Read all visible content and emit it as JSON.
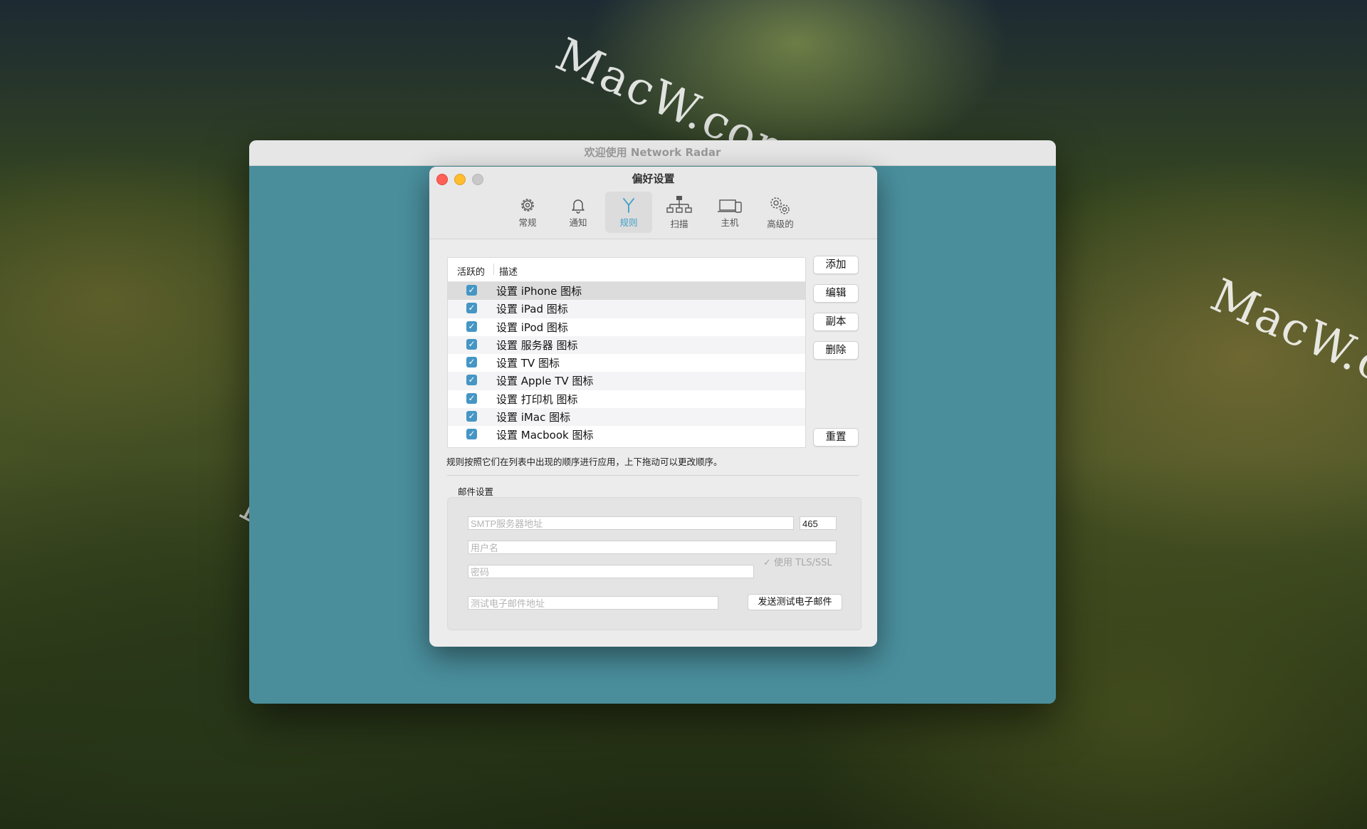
{
  "app_window": {
    "title": "欢迎使用 Network Radar"
  },
  "watermark": "MacW.com",
  "prefs": {
    "title": "偏好设置",
    "tabs": [
      {
        "label": "常规",
        "icon": "gear-icon"
      },
      {
        "label": "通知",
        "icon": "bell-icon"
      },
      {
        "label": "规则",
        "icon": "rules-icon",
        "active": true
      },
      {
        "label": "扫描",
        "icon": "network-tree-icon"
      },
      {
        "label": "主机",
        "icon": "devices-icon"
      },
      {
        "label": "高级的",
        "icon": "gears-icon"
      }
    ],
    "rules": {
      "columns": {
        "active": "活跃的",
        "description": "描述"
      },
      "rows": [
        {
          "checked": true,
          "text": "设置 iPhone 图标"
        },
        {
          "checked": true,
          "text": "设置 iPad 图标"
        },
        {
          "checked": true,
          "text": "设置 iPod 图标"
        },
        {
          "checked": true,
          "text": "设置 服务器 图标"
        },
        {
          "checked": true,
          "text": "设置 TV 图标"
        },
        {
          "checked": true,
          "text": "设置 Apple TV 图标"
        },
        {
          "checked": true,
          "text": "设置 打印机 图标"
        },
        {
          "checked": true,
          "text": "设置 iMac 图标"
        },
        {
          "checked": true,
          "text": "设置 Macbook 图标"
        }
      ],
      "buttons": {
        "add": "添加",
        "edit": "编辑",
        "duplicate": "副本",
        "delete": "删除",
        "reset": "重置"
      },
      "hint": "规则按照它们在列表中出现的顺序进行应用，上下拖动可以更改顺序。"
    },
    "mail": {
      "label": "邮件设置",
      "smtp_placeholder": "SMTP服务器地址",
      "port_value": "465",
      "username_placeholder": "用户名",
      "password_placeholder": "密码",
      "tls_label": "使用 TLS/SSL",
      "test_email_placeholder": "测试电子邮件地址",
      "send_button": "发送测试电子邮件"
    }
  },
  "colors": {
    "accent": "#3f9fc7",
    "checkbox": "#4596c4",
    "app_background": "#4a8e9c"
  }
}
